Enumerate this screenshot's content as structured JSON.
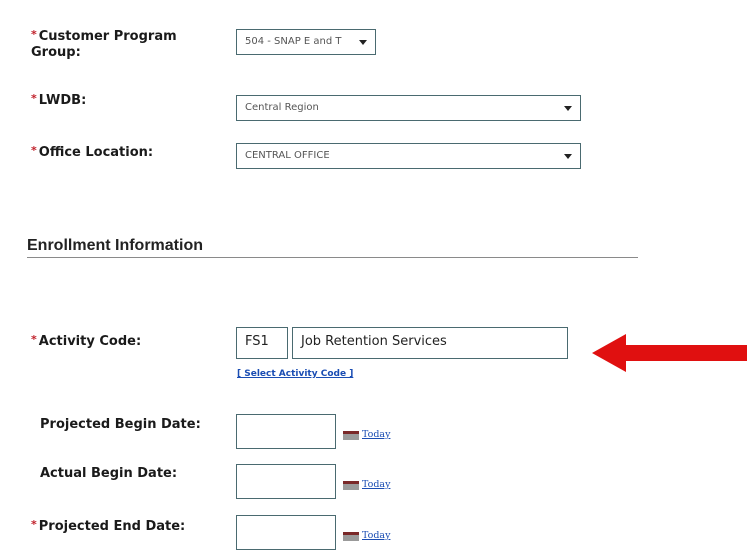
{
  "fields": {
    "customer_program_group": {
      "label": "Customer Program Group:",
      "value": "504 - SNAP E and T"
    },
    "lwdb": {
      "label": "LWDB:",
      "value": "Central Region"
    },
    "office_location": {
      "label": "Office Location:",
      "value": "CENTRAL OFFICE"
    }
  },
  "enrollment": {
    "section_title": "Enrollment Information",
    "activity_code": {
      "label": "Activity Code:",
      "code": "FS1",
      "description": "Job Retention Services",
      "select_link": "[ Select Activity Code ]"
    },
    "projected_begin_date": {
      "label": "Projected Begin Date:",
      "value": "",
      "today_link": "Today"
    },
    "actual_begin_date": {
      "label": "Actual Begin Date:",
      "value": "",
      "today_link": "Today"
    },
    "projected_end_date": {
      "label": "Projected End Date:",
      "value": "",
      "today_link": "Today"
    }
  },
  "required_marker": "*",
  "colors": {
    "required": "#c0202a",
    "link": "#1a4db3",
    "arrow": "#e01010",
    "field_border": "#4a6a70"
  },
  "annotation": {
    "type": "arrow",
    "direction": "left",
    "points_to": "activity_code"
  }
}
